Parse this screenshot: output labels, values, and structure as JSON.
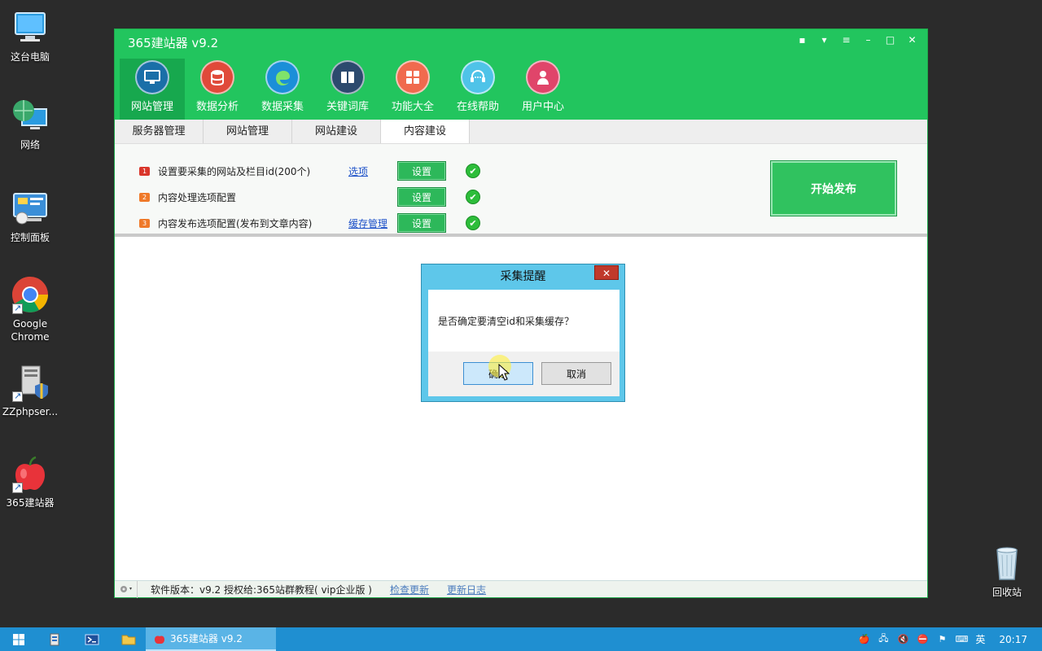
{
  "desktop": {
    "icons": [
      {
        "label": "这台电脑",
        "icon": "computer-icon"
      },
      {
        "label": "网络",
        "icon": "network-globe-icon"
      },
      {
        "label": "控制面板",
        "icon": "control-panel-icon"
      },
      {
        "label": "Google Chrome",
        "icon": "chrome-icon"
      },
      {
        "label": "ZZphpser...",
        "icon": "zzphpserver-icon"
      },
      {
        "label": "365建站器",
        "icon": "apple-app-icon"
      },
      {
        "label": "回收站",
        "icon": "recycle-bin-icon"
      }
    ]
  },
  "app": {
    "title": "365建站器 v9.2",
    "window_controls": [
      "chat-icon",
      "shirt-icon",
      "menu-down-icon",
      "minimize-icon",
      "maximize-icon",
      "close-icon"
    ],
    "nav": [
      {
        "label": "网站管理",
        "icon": "monitor-icon",
        "color": "#1a6fa8",
        "active": true
      },
      {
        "label": "数据分析",
        "icon": "database-icon",
        "color": "#e04a3a"
      },
      {
        "label": "数据采集",
        "icon": "edge-icon",
        "color": "#1b8fd8"
      },
      {
        "label": "关键词库",
        "icon": "book-icon",
        "color": "#2c4a6e"
      },
      {
        "label": "功能大全",
        "icon": "grid-icon",
        "color": "#f06a4e"
      },
      {
        "label": "在线帮助",
        "icon": "headset-icon",
        "color": "#4fc3e8"
      },
      {
        "label": "用户中心",
        "icon": "user-icon",
        "color": "#e0456a"
      }
    ],
    "tabs": [
      "服务器管理",
      "网站管理",
      "网站建设",
      "内容建设"
    ],
    "active_tab": "内容建设",
    "settings_rows": [
      {
        "num": "1",
        "label": "设置要采集的网站及栏目id(200个)",
        "link": "选项",
        "button": "设置",
        "num_color": "#d9362b"
      },
      {
        "num": "2",
        "label": "内容处理选项配置",
        "link": "",
        "button": "设置",
        "num_color": "#ef7a2a"
      },
      {
        "num": "3",
        "label": "内容发布选项配置(发布到文章内容)",
        "link": "缓存管理",
        "button": "设置",
        "num_color": "#ef7a2a"
      }
    ],
    "start_button": "开始发布",
    "status": {
      "version_text": "软件版本：v9.2   授权给:365站群教程( vip企业版 )",
      "check_update": "检查更新",
      "changelog": "更新日志"
    }
  },
  "dialog": {
    "title": "采集提醒",
    "close": "✕",
    "message": "是否确定要清空id和采集缓存？",
    "ok": "确定",
    "cancel": "取消"
  },
  "taskbar": {
    "task_label": "365建站器 v9.2",
    "ime": "英",
    "time": "20:17"
  }
}
